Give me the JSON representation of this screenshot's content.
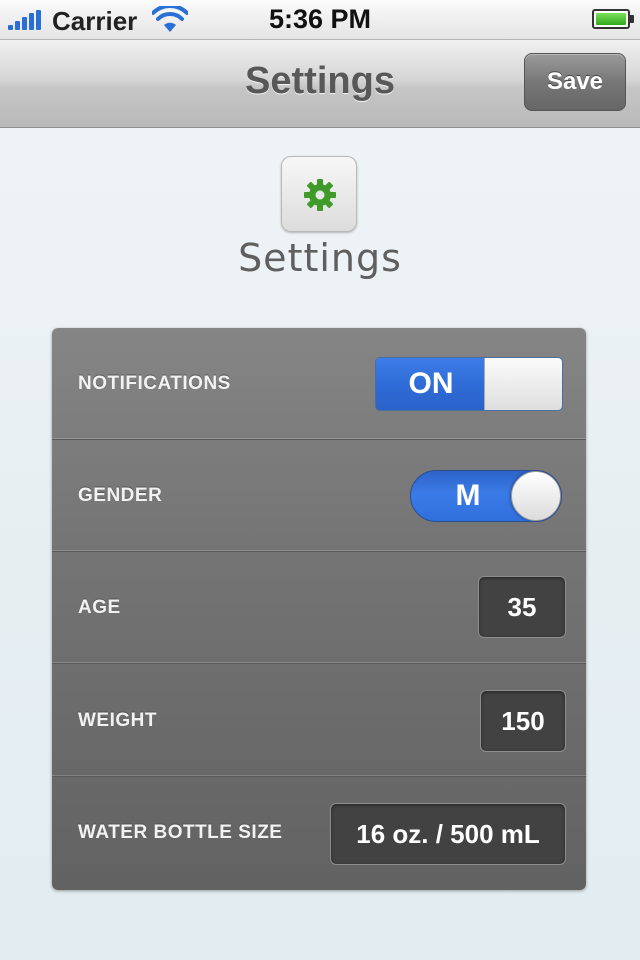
{
  "status_bar": {
    "carrier": "Carrier",
    "time": "5:36 PM",
    "battery_level": 1.0
  },
  "nav_bar": {
    "title": "Settings",
    "save_label": "Save"
  },
  "header": {
    "icon": "gear-icon",
    "title": "Settings"
  },
  "settings": {
    "notifications": {
      "label": "NOTIFICATIONS",
      "state": "ON"
    },
    "gender": {
      "label": "GENDER",
      "value": "M"
    },
    "age": {
      "label": "AGE",
      "value": "35"
    },
    "weight": {
      "label": "WEIGHT",
      "value": "150"
    },
    "water_bottle": {
      "label": "WATER BOTTLE SIZE",
      "value": "16 oz. / 500 mL"
    }
  },
  "colors": {
    "accent_blue": "#2f6cd8",
    "gear_green": "#3f9a2a",
    "panel_gray": "#747474"
  }
}
